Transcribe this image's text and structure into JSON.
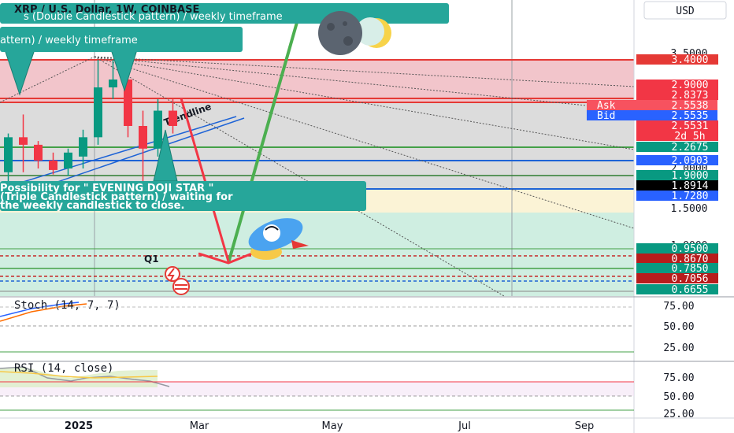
{
  "header": {
    "title": "XRP / U.S. Dollar, 1W, COINBASE",
    "callout_top": "s (Double Candlestick pattern) / weekly timeframe",
    "callout_second": "attern) / weekly timeframe",
    "currency": "USD"
  },
  "callout_bottom": {
    "line1": "Possibility for \" EVENING DOJI STAR \"",
    "line2": "(Triple Candlestick pattern) / waiting for",
    "line3": "the weekly candlestick to close."
  },
  "annotations": {
    "trendline_label": "Trendline",
    "q1_label": "Q1"
  },
  "price_axis": {
    "ticks": [
      "3.5000",
      "2.0000",
      "1.5000",
      "1.0000"
    ],
    "price_tags": [
      {
        "value": "3.4000",
        "color": "#e53935"
      },
      {
        "value": "2.9000",
        "color": "#f23645"
      },
      {
        "value": "2.8373",
        "color": "#f23645"
      },
      {
        "value": "Ask",
        "value2": "2.5538",
        "color": "#f7525f"
      },
      {
        "value": "Bid",
        "value2": "2.5535",
        "color": "#2962ff"
      },
      {
        "value": "2.5531",
        "value2": "2d 5h",
        "color": "#f23645"
      },
      {
        "value": "2.2675",
        "color": "#089981"
      },
      {
        "value": "2.0903",
        "color": "#2962ff"
      },
      {
        "value": "1.9000",
        "color": "#089981"
      },
      {
        "value": "1.8914",
        "color": "#000000"
      },
      {
        "value": "1.7280",
        "color": "#2962ff"
      },
      {
        "value": "0.9500",
        "color": "#089981"
      },
      {
        "value": "0.8670",
        "color": "#b71c1c"
      },
      {
        "value": "0.7850",
        "color": "#089981"
      },
      {
        "value": "0.7056",
        "color": "#b71c1c"
      },
      {
        "value": "0.6655",
        "color": "#089981"
      }
    ]
  },
  "stoch": {
    "title": "Stoch (14, 7, 7)",
    "ticks": [
      "75.00",
      "50.00",
      "25.00"
    ]
  },
  "rsi": {
    "title": "RSI (14, close)",
    "ticks": [
      "75.00",
      "50.00",
      "25.00"
    ]
  },
  "time_axis": {
    "labels": [
      "2025",
      "Mar",
      "May",
      "Jul",
      "Sep"
    ]
  },
  "chart_data": {
    "type": "candlestick",
    "title": "XRP / U.S. Dollar, 1W, COINBASE",
    "ylabel": "USD",
    "candles": [
      {
        "o": 1.95,
        "h": 2.45,
        "l": 1.75,
        "c": 2.4
      },
      {
        "o": 2.4,
        "h": 2.7,
        "l": 1.95,
        "c": 2.3
      },
      {
        "o": 2.3,
        "h": 2.35,
        "l": 2.0,
        "c": 2.1
      },
      {
        "o": 2.1,
        "h": 2.2,
        "l": 1.92,
        "c": 1.98
      },
      {
        "o": 2.0,
        "h": 2.25,
        "l": 1.9,
        "c": 2.2
      },
      {
        "o": 2.15,
        "h": 2.5,
        "l": 2.0,
        "c": 2.4
      },
      {
        "o": 2.4,
        "h": 3.4,
        "l": 2.3,
        "c": 3.05
      },
      {
        "o": 3.05,
        "h": 3.4,
        "l": 2.9,
        "c": 3.15
      },
      {
        "o": 3.15,
        "h": 3.2,
        "l": 2.4,
        "c": 2.55
      },
      {
        "o": 2.55,
        "h": 2.75,
        "l": 1.8,
        "c": 2.25
      },
      {
        "o": 2.25,
        "h": 2.9,
        "l": 2.15,
        "c": 2.75
      },
      {
        "o": 2.75,
        "h": 2.9,
        "l": 2.45,
        "c": 2.55
      }
    ],
    "horizontal_levels": [
      3.4,
      2.9,
      2.8373,
      2.2675,
      2.0903,
      1.9,
      1.728,
      0.95,
      0.867,
      0.785,
      0.7056,
      0.6655
    ],
    "zones": [
      {
        "from": 2.9,
        "to": 3.4,
        "color": "#f4c7cc"
      },
      {
        "from": 1.9,
        "to": 2.9,
        "color": "#d9d9d9"
      },
      {
        "from": 0.7,
        "to": 1.5,
        "color": "#cdeee0"
      }
    ]
  },
  "colors": {
    "up": "#089981",
    "down": "#f23645",
    "callout_bg": "#26a69a",
    "green_arrow": "#4caf50",
    "red_arrow": "#f23645"
  }
}
